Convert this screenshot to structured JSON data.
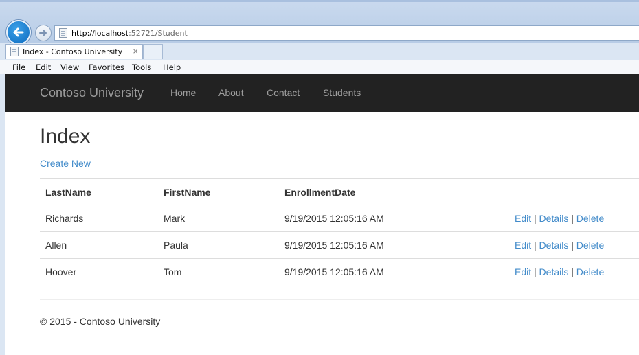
{
  "browser": {
    "url_host": "http://localhost",
    "url_rest": ":52721/Student",
    "tab_title": "Index - Contoso University",
    "tab_close": "×",
    "menu": [
      "File",
      "Edit",
      "View",
      "Favorites",
      "Tools",
      "Help"
    ]
  },
  "site": {
    "brand": "Contoso University",
    "nav": [
      "Home",
      "About",
      "Contact",
      "Students"
    ]
  },
  "page": {
    "title": "Index",
    "create_link": "Create New"
  },
  "table": {
    "headers": [
      "LastName",
      "FirstName",
      "EnrollmentDate"
    ],
    "rows": [
      {
        "last": "Richards",
        "first": "Mark",
        "date": "9/19/2015 12:05:16 AM"
      },
      {
        "last": "Allen",
        "first": "Paula",
        "date": "9/19/2015 12:05:16 AM"
      },
      {
        "last": "Hoover",
        "first": "Tom",
        "date": "9/19/2015 12:05:16 AM"
      }
    ],
    "actions": {
      "edit": "Edit",
      "details": "Details",
      "delete": "Delete",
      "separator": "|"
    }
  },
  "footer": {
    "text": "© 2015 - Contoso University"
  },
  "colors": {
    "navbar": "#222222",
    "link": "#428bca",
    "nav_text": "#9d9d9d"
  }
}
